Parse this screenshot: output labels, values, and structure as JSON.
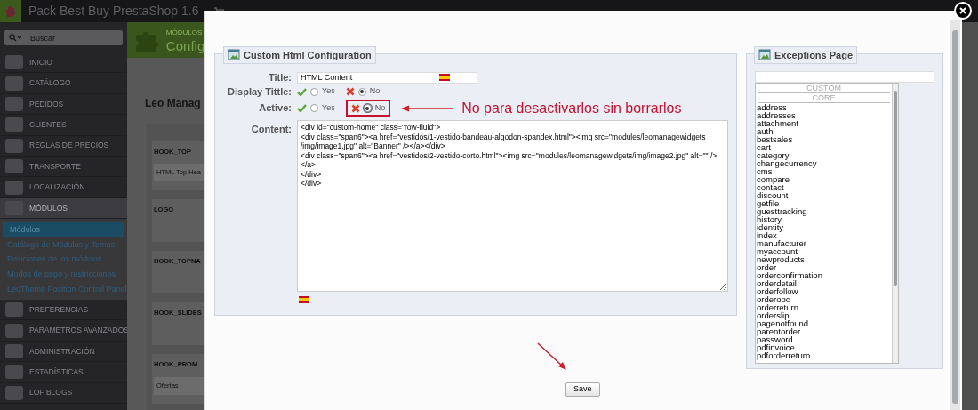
{
  "top_bar": {
    "title": "Pack Best Buy PrestaShop 1.6"
  },
  "sidebar": {
    "search": {
      "placeholder": "Buscar"
    },
    "items": [
      {
        "label": "INICIO",
        "expanded": false
      },
      {
        "label": "CATÁLOGO",
        "expanded": false
      },
      {
        "label": "PEDIDOS",
        "expanded": false
      },
      {
        "label": "CLIENTES",
        "expanded": false
      },
      {
        "label": "REGLAS DE PRECIOS",
        "expanded": false
      },
      {
        "label": "TRANSPORTE",
        "expanded": false
      },
      {
        "label": "LOCALIZACIÓN",
        "expanded": false
      },
      {
        "label": "MÓDULOS",
        "expanded": true,
        "children": [
          {
            "label": "Módulos",
            "selected": true
          },
          {
            "label": "Catálogo de Módulos y Temas",
            "selected": false
          },
          {
            "label": "Posiciones de los módulos",
            "selected": false
          },
          {
            "label": "Modos de pago y restricciones",
            "selected": false
          },
          {
            "label": "LeoTheme Position Control Panel",
            "selected": false
          }
        ]
      },
      {
        "label": "PREFERENCIAS",
        "expanded": false
      },
      {
        "label": "PARÁMETROS AVANZADOS",
        "expanded": false
      },
      {
        "label": "ADMINISTRACIÓN",
        "expanded": false
      },
      {
        "label": "ESTADÍSTICAS",
        "expanded": false
      },
      {
        "label": "LOF BLOGS",
        "expanded": false
      }
    ]
  },
  "page_header": {
    "breadcrumb": "MÓDULOS",
    "title": "Config"
  },
  "page": {
    "title": "Leo Manag",
    "hooks": [
      {
        "name": "HOOK_TOP",
        "widgets": [
          "HTML Top Hea"
        ]
      },
      {
        "name": "LOGO"
      },
      {
        "name": "HOOK_TOPNA"
      },
      {
        "name": "HOOK_SLIDES"
      },
      {
        "name": "HOOK_PROM",
        "widgets": [
          "Ofertas"
        ]
      }
    ]
  },
  "modal": {
    "config": {
      "legend": "Custom Html Configuration",
      "title_field": {
        "label": "Title:",
        "value": "HTML Content"
      },
      "switches": [
        {
          "label": "Display Tittle:",
          "highlighted": false,
          "options": [
            {
              "kind": "yes",
              "label": "Yes",
              "selected": false
            },
            {
              "kind": "no",
              "label": "No",
              "selected": true
            }
          ]
        },
        {
          "label": "Active:",
          "highlighted": true,
          "options": [
            {
              "kind": "yes",
              "label": "Yes",
              "selected": false
            },
            {
              "kind": "no",
              "label": "No",
              "selected": true
            }
          ]
        }
      ],
      "content": {
        "label": "Content:",
        "value": "<div id=\"custom-home\" class=\"row-fluid\">\n<div class=\"span6\"><a href=\"vestidos/1-vestido-bandeau-algodon-spandex.html\"><img src=\"modules/leomanagewidgets\n/img/image1.jpg\" alt=\"Banner\" /></a></div>\n<div class=\"span6\"><a href=\"vestidos/2-vestido-corto.html\"><img src=\"modules/leomanagewidgets/img/image2.jpg\" alt=\"\" /></a>\n</div>\n</div>"
      }
    },
    "annotation": "No para desactivarlos sin borrarlos",
    "exceptions": {
      "legend": "Exceptions Page",
      "groups": [
        {
          "label": "CUSTOM"
        },
        {
          "label": "CORE",
          "options": [
            "address",
            "addresses",
            "attachment",
            "auth",
            "bestsales",
            "cart",
            "category",
            "changecurrency",
            "cms",
            "compare",
            "contact",
            "discount",
            "getfile",
            "guesttracking",
            "history",
            "identity",
            "index",
            "manufacturer",
            "myaccount",
            "newproducts",
            "order",
            "orderconfirmation",
            "orderdetail",
            "orderfollow",
            "orderopc",
            "orderreturn",
            "orderslip",
            "pagenotfound",
            "parentorder",
            "password",
            "pdfinvoice",
            "pdforderreturn"
          ]
        }
      ]
    },
    "save": "Save"
  }
}
